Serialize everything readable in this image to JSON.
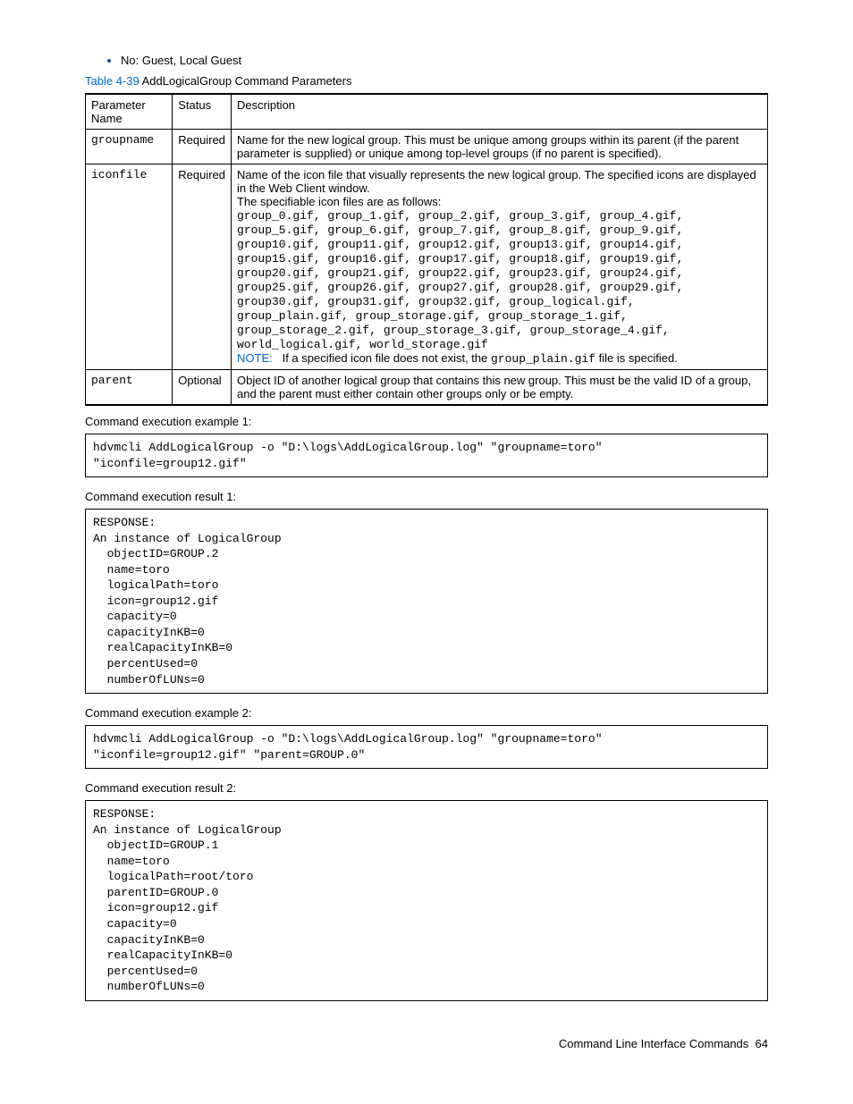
{
  "bullet_item": "No: Guest, Local Guest",
  "caption": {
    "link": "Table 4-39",
    "rest": "  AddLogicalGroup Command Parameters"
  },
  "headers": {
    "c1": "Parameter Name",
    "c2": "Status",
    "c3": "Description"
  },
  "rows": {
    "r1": {
      "name": "groupname",
      "status": "Required",
      "desc": "Name for the new logical group. This must be unique among groups within its parent (if the parent parameter is supplied) or unique among top-level groups (if no parent is specified)."
    },
    "r2": {
      "name": "iconfile",
      "status": "Required",
      "desc_intro1": "Name of the icon file that visually represents the new logical group. The specified icons are displayed in the Web Client window.",
      "desc_intro2": "The specifiable icon files are as follows:",
      "filelist": "group_0.gif, group_1.gif, group_2.gif, group_3.gif, group_4.gif,\ngroup_5.gif, group_6.gif, group_7.gif, group_8.gif, group_9.gif,\ngroup10.gif, group11.gif, group12.gif, group13.gif, group14.gif,\ngroup15.gif, group16.gif, group17.gif, group18.gif, group19.gif,\ngroup20.gif, group21.gif, group22.gif, group23.gif, group24.gif,\ngroup25.gif, group26.gif, group27.gif, group28.gif, group29.gif,\ngroup30.gif, group31.gif, group32.gif, group_logical.gif,\ngroup_plain.gif, group_storage.gif, group_storage_1.gif,\ngroup_storage_2.gif, group_storage_3.gif, group_storage_4.gif,\nworld_logical.gif, world_storage.gif",
      "note_label": "NOTE:",
      "note_pre": "If a specified icon file does not exist, the ",
      "note_code": "group_plain.gif",
      "note_post": " file is specified."
    },
    "r3": {
      "name": "parent",
      "status": "Optional",
      "desc": "Object ID of another logical group that contains this new group. This must be the valid ID of a group, and the parent must either contain other groups only or be empty."
    }
  },
  "labels": {
    "ex1": "Command execution example 1:",
    "res1": "Command execution result 1:",
    "ex2": "Command execution example 2:",
    "res2": "Command execution result 2:"
  },
  "code": {
    "ex1": "hdvmcli AddLogicalGroup -o \"D:\\logs\\AddLogicalGroup.log\" \"groupname=toro\"\n\"iconfile=group12.gif\"",
    "res1": "RESPONSE:\nAn instance of LogicalGroup\n  objectID=GROUP.2\n  name=toro\n  logicalPath=toro\n  icon=group12.gif\n  capacity=0\n  capacityInKB=0\n  realCapacityInKB=0\n  percentUsed=0\n  numberOfLUNs=0",
    "ex2": "hdvmcli AddLogicalGroup -o \"D:\\logs\\AddLogicalGroup.log\" \"groupname=toro\"\n\"iconfile=group12.gif\" \"parent=GROUP.0\"",
    "res2": "RESPONSE:\nAn instance of LogicalGroup\n  objectID=GROUP.1\n  name=toro\n  logicalPath=root/toro\n  parentID=GROUP.0\n  icon=group12.gif\n  capacity=0\n  capacityInKB=0\n  realCapacityInKB=0\n  percentUsed=0\n  numberOfLUNs=0"
  },
  "footer": {
    "text": "Command Line Interface Commands",
    "page": "64"
  }
}
